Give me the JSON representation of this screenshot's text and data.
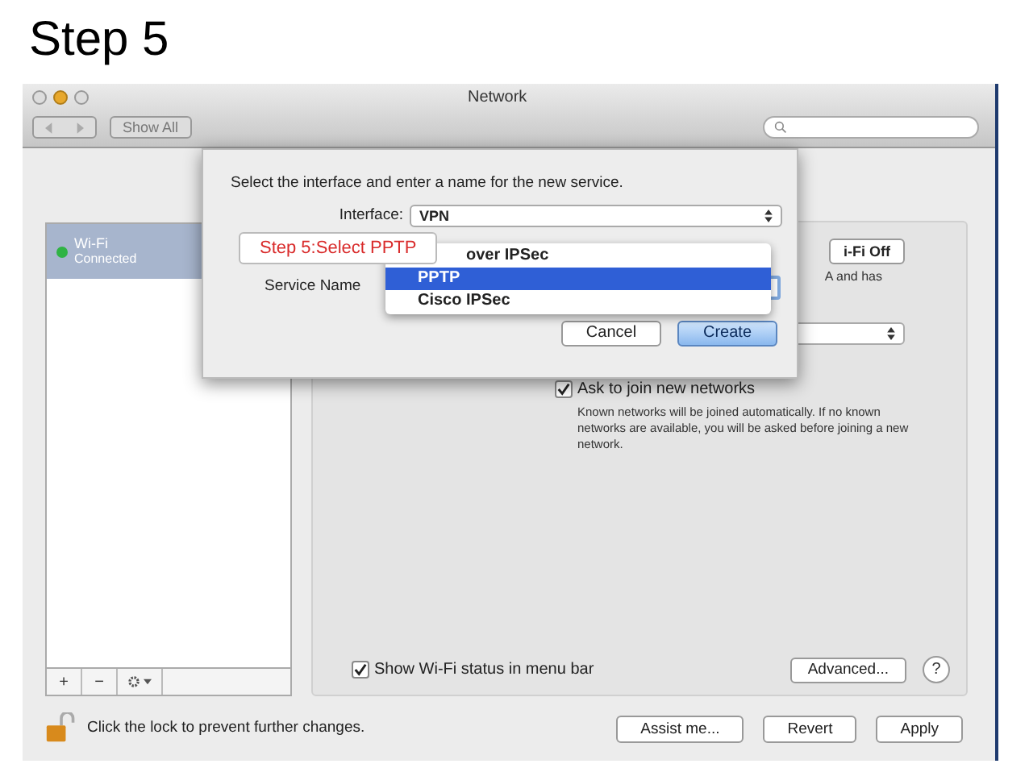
{
  "slide_title": "Step 5",
  "window": {
    "title": "Network",
    "show_all": "Show All"
  },
  "sidebar": {
    "services": [
      {
        "name": "Wi-Fi",
        "status": "Connected",
        "selected": true,
        "color": "#2fb344"
      }
    ],
    "buttons": [
      "+",
      "−"
    ]
  },
  "panel": {
    "power_button": "i-Fi Off",
    "status_text": "A and has",
    "ask_to_join": {
      "label": "Ask to join new networks",
      "checked": true,
      "description": "Known networks will be joined automatically. If no known networks are available, you will be asked before joining a new network."
    },
    "show_status": {
      "label": "Show Wi-Fi status in menu bar",
      "checked": true
    },
    "advanced": "Advanced...",
    "help": "?"
  },
  "footer": {
    "lock_text": "Click the lock to prevent further changes.",
    "buttons": [
      "Assist me...",
      "Revert",
      "Apply"
    ]
  },
  "dialog": {
    "prompt": "Select the interface and enter a name for the new service.",
    "interface": {
      "label": "Interface:",
      "value": "VPN"
    },
    "service_name_label": "Service Name",
    "menu": [
      {
        "label": "over IPSec",
        "selected": false,
        "kind": "covered"
      },
      {
        "label": "PPTP",
        "selected": true,
        "kind": "option"
      },
      {
        "label": "Cisco IPSec",
        "selected": false,
        "kind": "option"
      }
    ],
    "buttons": [
      {
        "label": "Cancel",
        "default": false
      },
      {
        "label": "Create",
        "default": true
      }
    ]
  },
  "callout": "Step 5:Select PPTP"
}
